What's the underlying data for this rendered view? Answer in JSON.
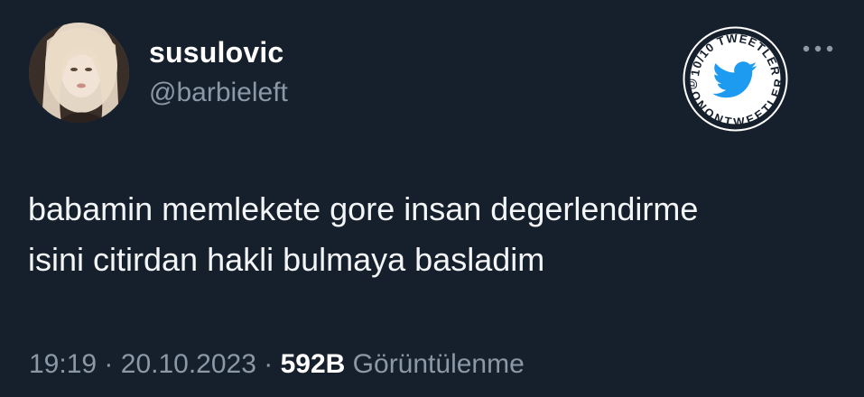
{
  "user": {
    "display_name": "susulovic",
    "handle": "@barbieleft",
    "avatar_icon": "profile-photo"
  },
  "badge": {
    "top_text": "10/10 TWEETLER",
    "bottom_text": "@ONONTWEETLER",
    "icon": "twitter-bird-icon",
    "bird_color": "#1d9bf0"
  },
  "more_icon": "ellipsis-icon",
  "tweet": {
    "lines": [
      "babamin memlekete gore insan degerlendirme",
      "isini citirdan hakli bulmaya basladim"
    ]
  },
  "meta": {
    "time": "19:19",
    "separator": "·",
    "date": "20.10.2023",
    "views_count": "592B",
    "views_label": "Görüntülenme"
  },
  "colors": {
    "background": "#16202c",
    "secondary_text": "#8b98a5",
    "primary_text": "#ffffff"
  }
}
